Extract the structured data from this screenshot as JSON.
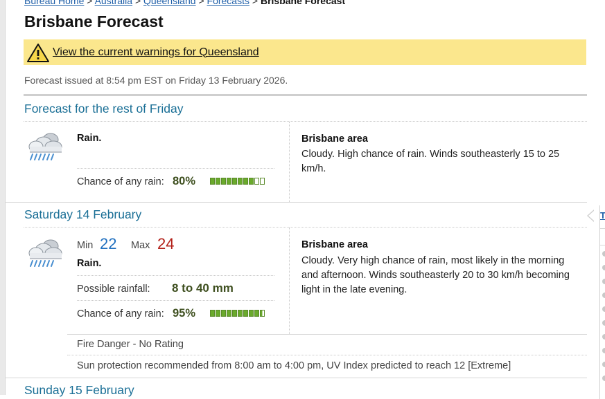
{
  "breadcrumb": {
    "items": [
      "Bureau Home",
      "Australia",
      "Queensland",
      "Forecasts"
    ],
    "separator": ">",
    "current": "Brisbane Forecast"
  },
  "page": {
    "title": "Brisbane Forecast",
    "warning_link": "View the current warnings for Queensland",
    "issued": "Forecast issued at 8:54 pm EST on Friday 13 February 2026."
  },
  "days": [
    {
      "title": "Forecast for the rest of Friday",
      "icon": "rain-cloud-icon",
      "summary": "Rain.",
      "chance_label": "Chance of any rain:",
      "chance_value": "80%",
      "chance_fraction": 0.8,
      "area_title": "Brisbane area",
      "area_text": "Cloudy. High chance of rain. Winds southeasterly 15 to 25 km/h."
    },
    {
      "title": "Saturday 14 February",
      "icon": "rain-cloud-icon",
      "min_label": "Min",
      "min_value": "22",
      "max_label": "Max",
      "max_value": "24",
      "summary": "Rain.",
      "rainfall_label": "Possible rainfall:",
      "rainfall_value": "8 to 40 mm",
      "chance_label": "Chance of any rain:",
      "chance_value": "95%",
      "chance_fraction": 0.95,
      "area_title": "Brisbane area",
      "area_text": "Cloudy. Very high chance of rain, most likely in the morning and afternoon. Winds southeasterly 20 to 30 km/h becoming light in the late evening.",
      "fire_danger": "Fire Danger - No Rating",
      "uv": "Sun protection recommended from 8:00 am to 4:00 pm, UV Index predicted to reach 12 [Extreme]"
    },
    {
      "title": "Sunday 15 February"
    }
  ],
  "side_panel": {
    "link_text": "T"
  },
  "colors": {
    "warning_bg": "#fbe78d",
    "day_title": "#1a6f96",
    "min_temp": "#1f6fbf",
    "max_temp": "#b3211a",
    "rain_bar": "#6aaa2c"
  }
}
